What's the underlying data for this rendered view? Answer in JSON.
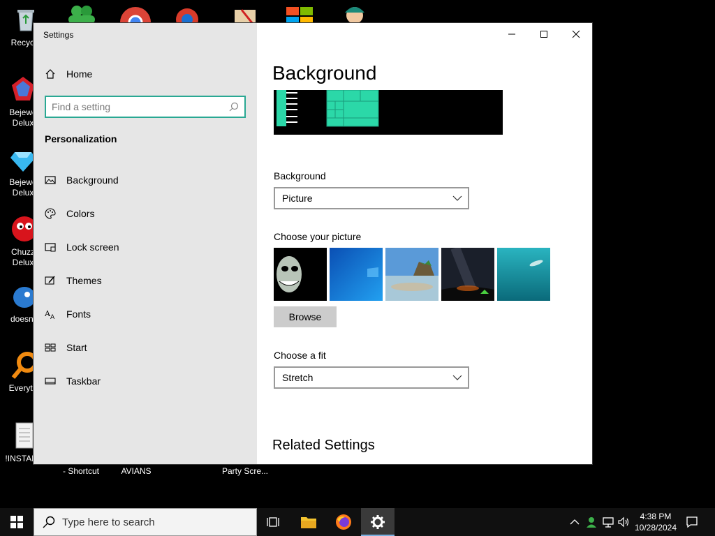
{
  "desktop": {
    "icons_left": [
      {
        "label": "Recycle"
      },
      {
        "label": "Bejewe\nDelux"
      },
      {
        "label": "Bejewe\nDelux"
      },
      {
        "label": "Chuzz\nDelux"
      },
      {
        "label": "doesnt"
      },
      {
        "label": "Everyth"
      },
      {
        "label": "!INSTALL"
      }
    ],
    "bottom_labels": [
      "- Shortcut",
      "AVIANS",
      "Party Scre..."
    ]
  },
  "window": {
    "title": "Settings",
    "sidebar": {
      "home_label": "Home",
      "search_placeholder": "Find a setting",
      "section_title": "Personalization",
      "items": [
        {
          "label": "Background",
          "icon": "picture-icon"
        },
        {
          "label": "Colors",
          "icon": "palette-icon"
        },
        {
          "label": "Lock screen",
          "icon": "lock-screen-icon"
        },
        {
          "label": "Themes",
          "icon": "brush-icon"
        },
        {
          "label": "Fonts",
          "icon": "fonts-icon"
        },
        {
          "label": "Start",
          "icon": "start-icon"
        },
        {
          "label": "Taskbar",
          "icon": "taskbar-icon"
        }
      ]
    },
    "content": {
      "page_title": "Background",
      "background_label": "Background",
      "background_value": "Picture",
      "choose_picture_label": "Choose your picture",
      "browse_label": "Browse",
      "fit_label": "Choose a fit",
      "fit_value": "Stretch",
      "related_title": "Related Settings"
    }
  },
  "taskbar": {
    "search_placeholder": "Type here to search",
    "time": "4:38 PM",
    "date": "10/28/2024"
  },
  "colors": {
    "accent": "#2aa893",
    "sidebar_bg": "#e6e6e6",
    "taskbar_bg": "#101010"
  }
}
